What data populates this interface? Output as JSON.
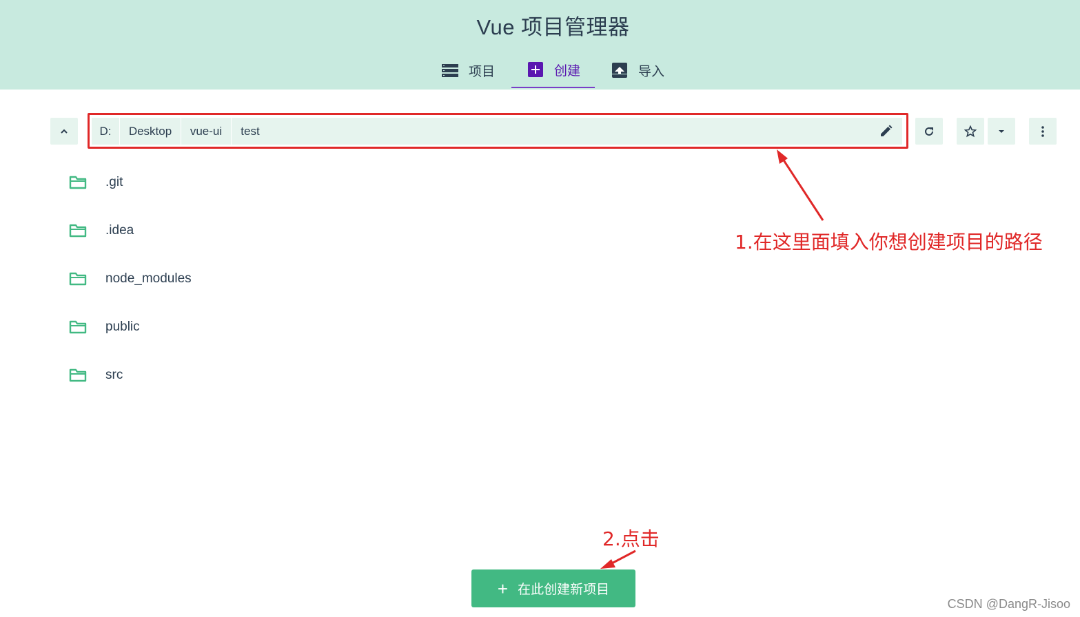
{
  "header": {
    "title": "Vue 项目管理器",
    "tabs": [
      {
        "label": "项目",
        "icon": "list-icon",
        "active": false
      },
      {
        "label": "创建",
        "icon": "add-box-icon",
        "active": true
      },
      {
        "label": "导入",
        "icon": "unarchive-icon",
        "active": false
      }
    ]
  },
  "path_bar": {
    "segments": [
      "D:",
      "Desktop",
      "vue-ui",
      "test"
    ]
  },
  "folders": [
    ".git",
    ".idea",
    "node_modules",
    "public",
    "src"
  ],
  "annotations": {
    "step1": "1.在这里面填入你想创建项目的路径",
    "step2": "2.点击"
  },
  "actions": {
    "create_here_label": "在此创建新项目"
  },
  "watermark": "CSDN @DangR-Jisoo",
  "colors": {
    "header_bg": "#c8eadf",
    "accent_green": "#42b983",
    "active_tab": "#5a17b0",
    "annotation_red": "#e02828",
    "folder_icon": "#42b983"
  }
}
